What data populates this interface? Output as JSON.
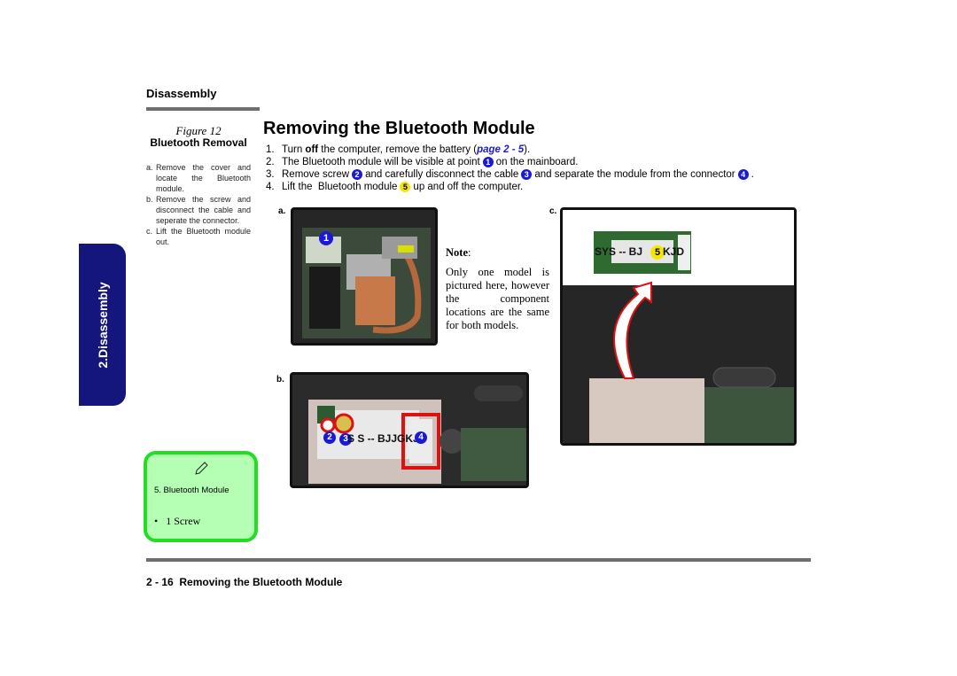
{
  "header": {
    "section": "Disassembly"
  },
  "figure": {
    "caption": "Figure 12",
    "title": "Bluetooth  Removal",
    "steps": [
      {
        "label": "a.",
        "text": "Remove the cover and locate the Bluetooth module."
      },
      {
        "label": "b.",
        "text": "Remove the screw and disconnect the cable and seperate the connector."
      },
      {
        "label": "c.",
        "text": "Lift the Bluetooth module out."
      }
    ]
  },
  "main": {
    "title": "Removing the Bluetooth Module",
    "steps": [
      {
        "num": "1.",
        "pre": "Turn ",
        "bold": "off",
        "mid": " the computer, remove the battery (",
        "link": "page 2 - 5",
        "post": ")."
      },
      {
        "num": "2.",
        "pre": "The Bluetooth module will be visible at point",
        "badge": "1",
        "post": "on the mainboard."
      },
      {
        "num": "3.",
        "pre": "Remove screw",
        "badge": "2",
        "mid": "and carefully disconnect the cable",
        "badge2": "3",
        "mid2": "and separate the module from the connector",
        "badge3": "4",
        "post": "."
      },
      {
        "num": "4.",
        "pre": "Lift the  Bluetooth module",
        "badge": "5",
        "post": "up and off the computer."
      }
    ]
  },
  "panels": {
    "a": {
      "label": "a.",
      "badge": "1"
    },
    "b": {
      "label": "b.",
      "badges": [
        "2",
        "3",
        "4"
      ],
      "module_text": "S  S -- BJJGKJD"
    },
    "c": {
      "label": "c.",
      "badge": "5",
      "module_text": "SYS -- BJ",
      "module_text2": "KJD"
    }
  },
  "note": {
    "title": "Note",
    "body": "Only one model is pictured here, however the component locations are the same for both models."
  },
  "side_tab": {
    "label": "2.Disassembly"
  },
  "parts_box": {
    "icon": "pencil-icon",
    "item": "5.   Bluetooth Module",
    "bullet": "1 Screw"
  },
  "footer": {
    "text": "2 - 16  Removing the Bluetooth Module"
  }
}
